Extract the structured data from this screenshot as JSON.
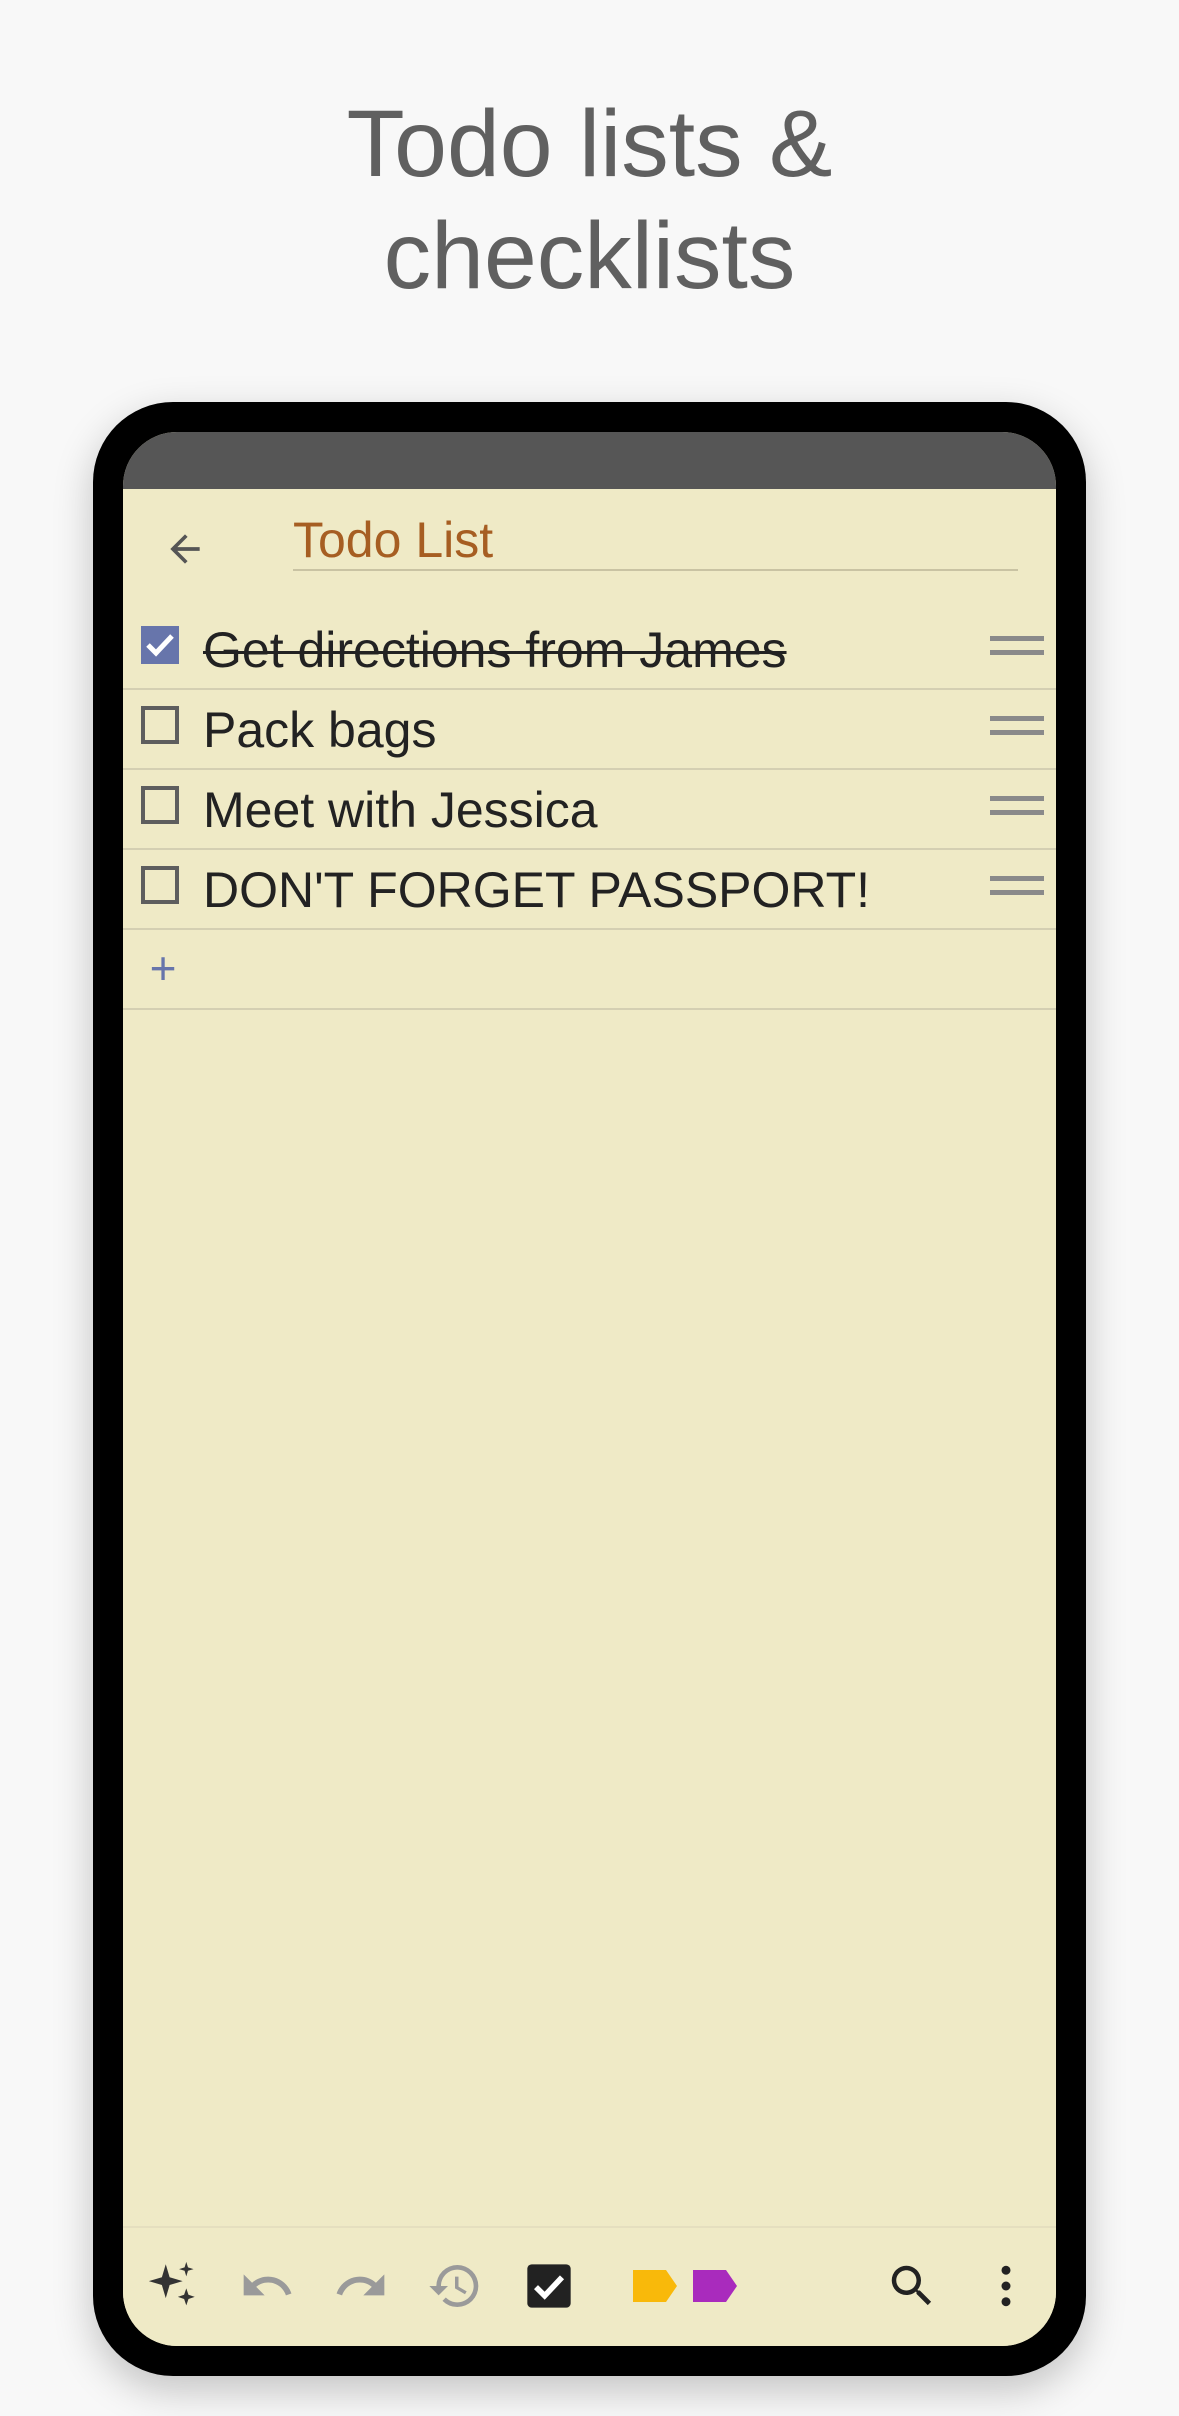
{
  "headline": {
    "line1": "Todo lists &",
    "line2": "checklists"
  },
  "note": {
    "title": "Todo List",
    "items": [
      {
        "text": "Get directions from James",
        "checked": true
      },
      {
        "text": "Pack bags",
        "checked": false
      },
      {
        "text": "Meet with Jessica",
        "checked": false
      },
      {
        "text": "DON'T FORGET PASSPORT!",
        "checked": false
      }
    ],
    "add_label": "+"
  },
  "toolbar": {
    "icons": [
      "sparkle-icon",
      "undo-icon",
      "redo-icon",
      "history-icon",
      "checkbox-icon",
      "label-yellow-icon",
      "label-purple-icon",
      "search-icon",
      "more-vert-icon"
    ]
  },
  "colors": {
    "page_bg": "#f8f8f8",
    "note_bg": "#efeac6",
    "title": "#a65e22",
    "checkbox_accent": "#6775ab",
    "label_yellow": "#f9b90a",
    "label_purple": "#a92bbd"
  }
}
